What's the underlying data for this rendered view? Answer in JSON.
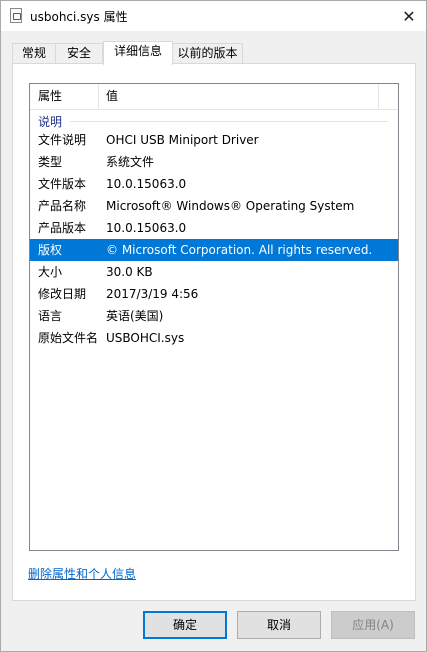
{
  "window": {
    "title": "usbohci.sys 属性",
    "close_symbol": "✕"
  },
  "tabs": [
    {
      "label": "常规"
    },
    {
      "label": "安全"
    },
    {
      "label": "详细信息"
    },
    {
      "label": "以前的版本"
    }
  ],
  "active_tab": "详细信息",
  "list": {
    "headers": {
      "property": "属性",
      "value": "值"
    },
    "group": "说明",
    "rows": [
      {
        "property": "文件说明",
        "value": "OHCI USB Miniport Driver"
      },
      {
        "property": "类型",
        "value": "系统文件"
      },
      {
        "property": "文件版本",
        "value": "10.0.15063.0"
      },
      {
        "property": "产品名称",
        "value": "Microsoft® Windows® Operating System"
      },
      {
        "property": "产品版本",
        "value": "10.0.15063.0"
      },
      {
        "property": "版权",
        "value": "© Microsoft Corporation. All rights reserved."
      },
      {
        "property": "大小",
        "value": "30.0 KB"
      },
      {
        "property": "修改日期",
        "value": "2017/3/19 4:56"
      },
      {
        "property": "语言",
        "value": "英语(美国)"
      },
      {
        "property": "原始文件名",
        "value": "USBOHCI.sys"
      }
    ],
    "selected_row": "版权"
  },
  "remove_link": "删除属性和个人信息",
  "buttons": {
    "ok": "确定",
    "cancel": "取消",
    "apply": "应用(A)"
  },
  "colors": {
    "selection": "#0078d7",
    "link": "#0066cc",
    "group_label": "#1e3287"
  }
}
